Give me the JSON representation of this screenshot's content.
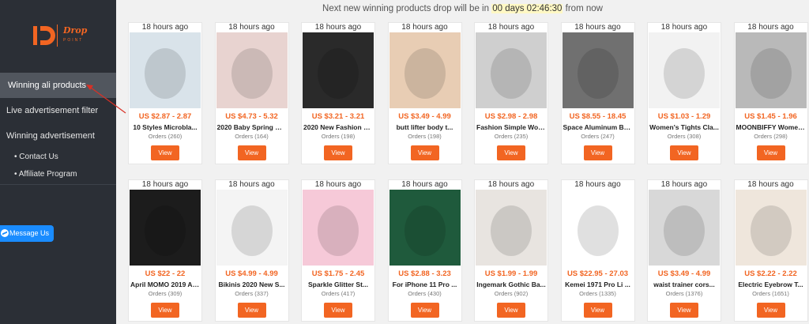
{
  "topbar": {
    "prefix": "Next new winning products drop will be in",
    "countdown": "00 days 02:46:30",
    "suffix": "from now"
  },
  "logo": {
    "line1": "Drop",
    "line2": "POINT"
  },
  "sidebar": {
    "active": "Winning ali products",
    "items": [
      "Live advertisement filter",
      "Winning advertisement"
    ],
    "subitems": [
      "Contact Us",
      "Affiliate Program"
    ]
  },
  "messenger": {
    "label": "Message Us"
  },
  "view_label": "View",
  "products": [
    {
      "age": "18 hours ago",
      "price": "US $2.87 - 2.87",
      "title": "10 Styles Microbla...",
      "orders": "Orders (260)",
      "icon": "eyebrow-stencil-image",
      "color": "#d9e3ea"
    },
    {
      "age": "18 hours ago",
      "price": "US $4.73 - 5.32",
      "title": "2020 Baby Spring W...",
      "orders": "Orders (164)",
      "icon": "baby-clothes-image",
      "color": "#e8d3d0"
    },
    {
      "age": "18 hours ago",
      "price": "US $3.21 - 3.21",
      "title": "2020 New Fashion K...",
      "orders": "Orders (198)",
      "icon": "knee-pad-image",
      "color": "#2a2a2a"
    },
    {
      "age": "18 hours ago",
      "price": "US $3.49 - 4.99",
      "title": "butt lifter body t...",
      "orders": "Orders (198)",
      "icon": "body-shaper-image",
      "color": "#e8cdb4"
    },
    {
      "age": "18 hours ago",
      "price": "US $2.98 - 2.98",
      "title": "Fashion Simple Wom...",
      "orders": "Orders (235)",
      "icon": "watch-image",
      "color": "#cfcfcf"
    },
    {
      "age": "18 hours ago",
      "price": "US $8.55 - 18.45",
      "title": "Space Aluminum Bat...",
      "orders": "Orders (247)",
      "icon": "shower-shelf-image",
      "color": "#707070"
    },
    {
      "age": "18 hours ago",
      "price": "US $1.03 - 1.29",
      "title": "Women's Tights Cla...",
      "orders": "Orders (308)",
      "icon": "tights-image",
      "color": "#f2f2f2"
    },
    {
      "age": "18 hours ago",
      "price": "US $1.45 - 1.96",
      "title": "MOONBIFFY Women Wa...",
      "orders": "Orders (298)",
      "icon": "mesh-watch-image",
      "color": "#b9b9b9"
    },
    {
      "age": "18 hours ago",
      "price": "US $22 - 22",
      "title": "April MOMO 2019 Au...",
      "orders": "Orders (309)",
      "icon": "jacket-image",
      "color": "#1c1c1c"
    },
    {
      "age": "18 hours ago",
      "price": "US $4.99 - 4.99",
      "title": "Bikinis 2020 New S...",
      "orders": "Orders (337)",
      "icon": "bikini-image",
      "color": "#f4f4f4"
    },
    {
      "age": "18 hours ago",
      "price": "US $1.75 - 2.45",
      "title": "Sparkle Glitter St...",
      "orders": "Orders (417)",
      "icon": "phone-lanyard-image",
      "color": "#f6c9d8"
    },
    {
      "age": "18 hours ago",
      "price": "US $2.88 - 3.23",
      "title": "For iPhone 11 Pro ...",
      "orders": "Orders (430)",
      "icon": "phone-case-image",
      "color": "#1f5a3c"
    },
    {
      "age": "18 hours ago",
      "price": "US $1.99 - 1.99",
      "title": "Ingemark Gothic Ba...",
      "orders": "Orders (902)",
      "icon": "necklace-image",
      "color": "#e8e4e0"
    },
    {
      "age": "18 hours ago",
      "price": "US $22.95 - 27.03",
      "title": "Kemei 1971 Pro Li ...",
      "orders": "Orders (1335)",
      "icon": "trimmer-image",
      "color": "#ffffff"
    },
    {
      "age": "18 hours ago",
      "price": "US $3.49 - 4.99",
      "title": "waist trainer cors...",
      "orders": "Orders (1376)",
      "icon": "waist-trainer-image",
      "color": "#d8d8d8"
    },
    {
      "age": "18 hours ago",
      "price": "US $2.22 - 2.22",
      "title": "Electric Eyebrow T...",
      "orders": "Orders (1651)",
      "icon": "eyebrow-trimmer-image",
      "color": "#efe6dc"
    }
  ]
}
